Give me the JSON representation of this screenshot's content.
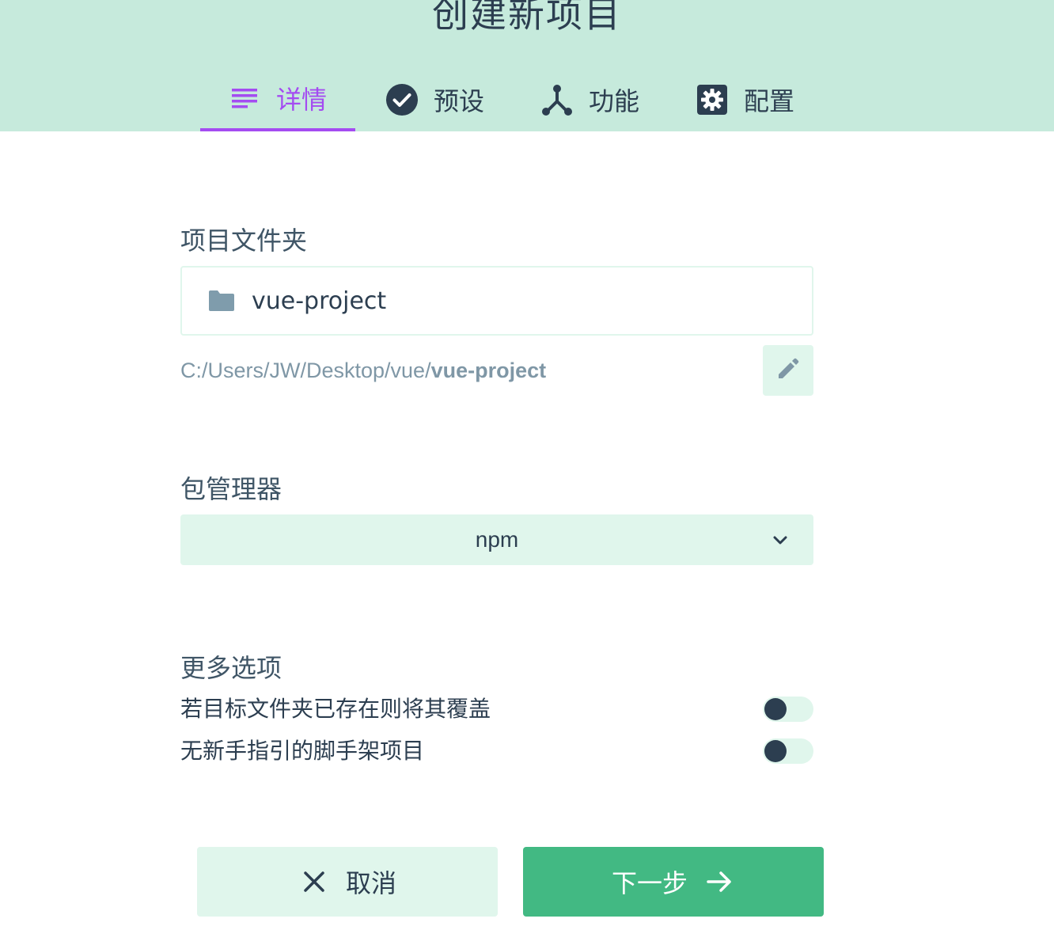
{
  "page_title": "创建新项目",
  "tabs": [
    {
      "label": "详情",
      "icon": "list-icon",
      "active": true
    },
    {
      "label": "预设",
      "icon": "check-circle-icon",
      "active": false
    },
    {
      "label": "功能",
      "icon": "fork-icon",
      "active": false
    },
    {
      "label": "配置",
      "icon": "settings-icon",
      "active": false
    }
  ],
  "project_folder": {
    "label": "项目文件夹",
    "value": "vue-project",
    "icon": "folder-icon",
    "path_prefix": "C:/Users/JW/Desktop/vue/",
    "path_name": "vue-project",
    "edit_icon": "pencil-icon"
  },
  "package_manager": {
    "label": "包管理器",
    "selected": "npm",
    "icon": "chevron-down-icon"
  },
  "more_options": {
    "label": "更多选项",
    "options": [
      {
        "label": "若目标文件夹已存在则将其覆盖",
        "enabled": false
      },
      {
        "label": "无新手指引的脚手架项目",
        "enabled": false
      }
    ]
  },
  "buttons": {
    "cancel": "取消",
    "next": "下一步"
  },
  "colors": {
    "header_bg": "#c6eadc",
    "accent": "#a44cf1",
    "primary": "#42b983",
    "light": "#e0f6ec",
    "text": "#2c3e50"
  }
}
